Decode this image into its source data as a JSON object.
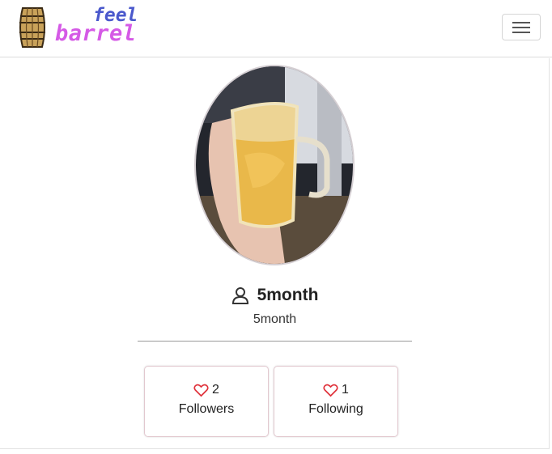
{
  "header": {
    "logo_line1": "feel",
    "logo_line2": "barrel",
    "logo_icon": "barrel-icon",
    "menu_icon": "hamburger-menu-icon"
  },
  "profile": {
    "avatar_description": "photo-avatar",
    "user_icon": "user-icon",
    "username": "5month",
    "handle": "5month"
  },
  "stats": [
    {
      "icon": "heart-icon",
      "count": "2",
      "label": "Followers"
    },
    {
      "icon": "heart-icon",
      "count": "1",
      "label": "Following"
    }
  ],
  "colors": {
    "logo_feel": "#4a58cc",
    "logo_barrel": "#d55ae6",
    "heart": "#e0333c",
    "card_border": "#e2c8cf"
  }
}
